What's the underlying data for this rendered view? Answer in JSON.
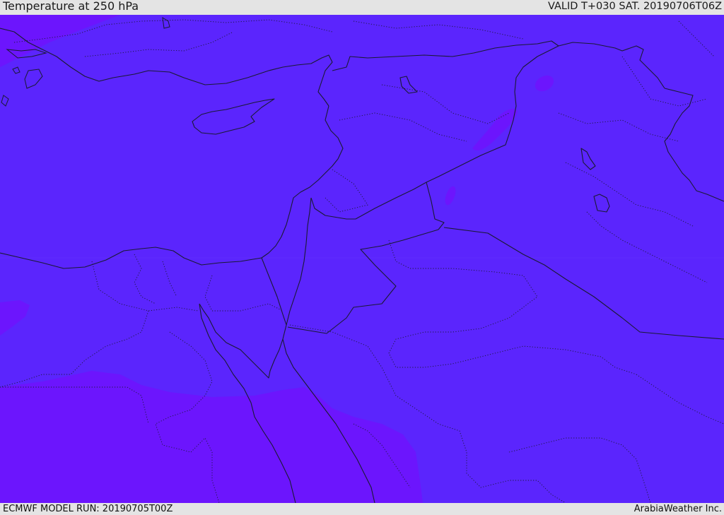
{
  "header": {
    "title": "Temperature at 250 hPa",
    "valid_time": "VALID T+030 SAT. 20190706T06Z"
  },
  "footer": {
    "model_run": "ECMWF MODEL RUN: 20190705T00Z",
    "credit": "ArabiaWeather Inc."
  },
  "map": {
    "colors": {
      "base_field": "#5b25fd",
      "warmer_field": "#6c15fd",
      "coastline": "#1a1a33"
    }
  }
}
